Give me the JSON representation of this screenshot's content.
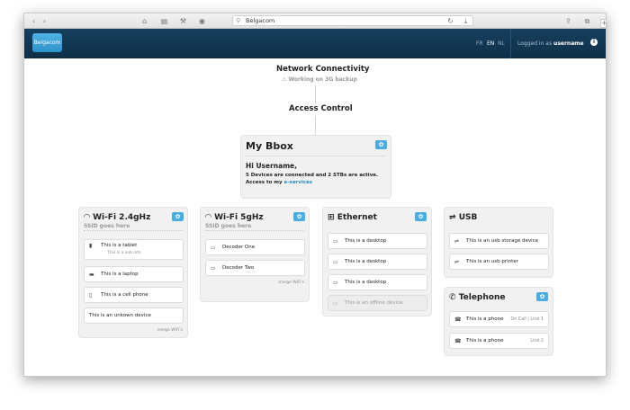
{
  "browser": {
    "url": "Belgacom",
    "back_icon": "‹",
    "forward_icon": "›",
    "home_icon": "⌂",
    "plus_label": "+"
  },
  "header": {
    "logo": "Belgacom",
    "languages": [
      "FR",
      "EN",
      "NL"
    ],
    "active_language": "EN",
    "logged_in_prefix": "Logged in as",
    "username": "username",
    "info_icon": "i"
  },
  "network": {
    "title": "Network Connectivity",
    "status": "⚠ Working on 3G backup"
  },
  "access_control": {
    "title": "Access Control"
  },
  "bbox": {
    "title": "My Bbox",
    "greeting": "Hi Username,",
    "line1": "5 Devices are connected and 2 STBs are active.",
    "line2_prefix": "Access to my",
    "link": "e-services"
  },
  "wifi24": {
    "title": "Wi-Fi 2.4gHz",
    "ssid": "SSID goes here",
    "devices": [
      {
        "label": "This is a tablet",
        "sub": "This is a sub info"
      },
      {
        "label": "This is a laptop"
      },
      {
        "label": "This is a cell phone"
      },
      {
        "label": "This is an unkown device"
      }
    ],
    "merge": "merge WiFi's"
  },
  "wifi5": {
    "title": "Wi-Fi 5gHz",
    "ssid": "SSID goes here",
    "devices": [
      {
        "label": "Decoder One"
      },
      {
        "label": "Decoder Two"
      }
    ],
    "merge": "merge WiFi's"
  },
  "ethernet": {
    "title": "Ethernet",
    "devices": [
      {
        "label": "This is a desktop"
      },
      {
        "label": "This is a desktop"
      },
      {
        "label": "This is a desktop"
      },
      {
        "label": "This is an offline device"
      }
    ]
  },
  "usb": {
    "title": "USB",
    "devices": [
      {
        "label": "This is an usb storage device"
      },
      {
        "label": "This is an usb printer"
      }
    ]
  },
  "telephone": {
    "title": "Telephone",
    "devices": [
      {
        "label": "This is a phone",
        "status": "On Call | Line 1"
      },
      {
        "label": "This is a phone",
        "status": "Line 2"
      }
    ]
  },
  "gear_icon": "✿"
}
